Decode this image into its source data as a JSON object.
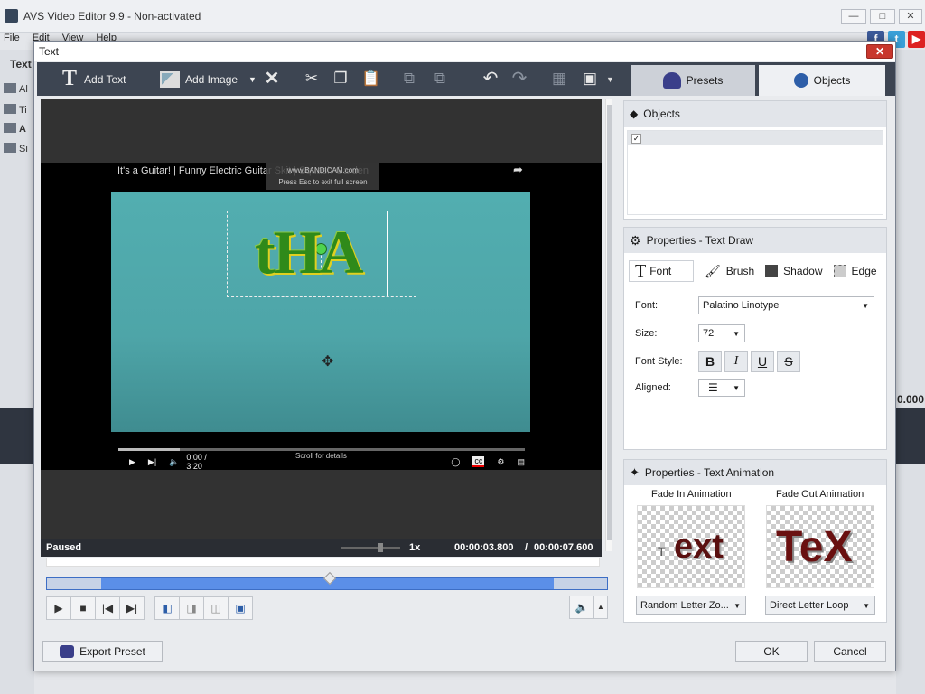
{
  "app": {
    "title": "AVS Video Editor 9.9 - Non-activated",
    "menu": [
      "File",
      "Edit",
      "View",
      "Help"
    ],
    "left_labels": [
      "Text",
      "Al",
      "Ti",
      "A",
      "Si"
    ],
    "bg_timecode": "0.000"
  },
  "dialog": {
    "title": "Text",
    "toolbar": {
      "add_text": "Add Text",
      "add_image": "Add Image"
    },
    "tabs": {
      "presets": "Presets",
      "objects": "Objects"
    },
    "preview": {
      "video_title": "It's a Guitar! | Funny Electric Guitar Skit | Squash Garden",
      "watermark_line1": "www.BANDICAM.com",
      "watermark_line2": "Press  Esc  to exit full screen",
      "yt_time": "0:00 / 3:20",
      "yt_scroll": "Scroll for details",
      "overlay_text": "tHA",
      "status": "Paused",
      "speed": "1x",
      "current_time": "00:00:03.800",
      "separator": "/",
      "total_time": "00:00:07.600"
    },
    "objects_panel": {
      "title": "Objects"
    },
    "props_panel": {
      "title": "Properties - Text Draw",
      "subtabs": {
        "font": "Font",
        "brush": "Brush",
        "shadow": "Shadow",
        "edge": "Edge"
      },
      "font_label": "Font:",
      "font_value": "Palatino Linotype",
      "size_label": "Size:",
      "size_value": "72",
      "style_label": "Font Style:",
      "style_b": "B",
      "style_i": "I",
      "style_u": "U",
      "style_s": "S",
      "aligned_label": "Aligned:"
    },
    "anim_panel": {
      "title": "Properties - Text Animation",
      "fade_in_label": "Fade In Animation",
      "fade_out_label": "Fade Out Animation",
      "fade_in_preview": "ext",
      "fade_in_prefix": "T",
      "fade_out_preview": "TeX",
      "fade_in_value": "Random Letter Zo...",
      "fade_out_value": "Direct Letter Loop"
    },
    "buttons": {
      "export_preset": "Export Preset",
      "ok": "OK",
      "cancel": "Cancel"
    }
  },
  "colors": {
    "accent_blue": "#5b8fe8",
    "toolbar": "#3d4552",
    "close_red": "#c8372d"
  }
}
